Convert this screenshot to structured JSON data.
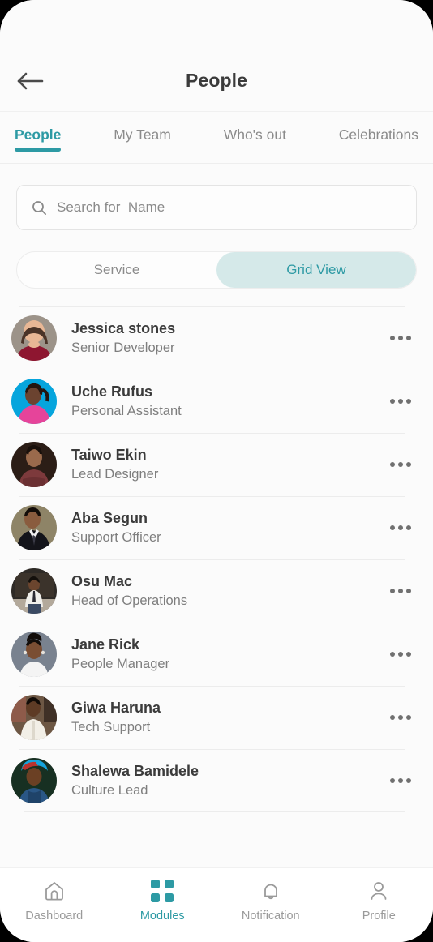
{
  "header": {
    "title": "People",
    "back_icon": "arrow-left-icon"
  },
  "tabs": [
    {
      "label": "People",
      "active": true
    },
    {
      "label": "My Team",
      "active": false
    },
    {
      "label": "Who's out",
      "active": false
    },
    {
      "label": "Celebrations",
      "active": false
    }
  ],
  "search": {
    "placeholder": "Search for  Name",
    "value": "",
    "icon": "search-icon"
  },
  "segmented": {
    "options": [
      {
        "label": "Service",
        "active": false
      },
      {
        "label": "Grid View",
        "active": true
      }
    ]
  },
  "people": [
    {
      "name": "Jessica stones",
      "role": "Senior Developer"
    },
    {
      "name": "Uche Rufus",
      "role": "Personal Assistant"
    },
    {
      "name": "Taiwo Ekin",
      "role": "Lead Designer"
    },
    {
      "name": "Aba Segun",
      "role": "Support Officer"
    },
    {
      "name": "Osu Mac",
      "role": "Head of Operations"
    },
    {
      "name": "Jane Rick",
      "role": "People Manager"
    },
    {
      "name": "Giwa Haruna",
      "role": "Tech Support"
    },
    {
      "name": "Shalewa Bamidele",
      "role": "Culture Lead"
    }
  ],
  "bottom_nav": [
    {
      "label": "Dashboard",
      "icon": "home-icon",
      "active": false
    },
    {
      "label": "Modules",
      "icon": "grid-icon",
      "active": true
    },
    {
      "label": "Notification",
      "icon": "bell-icon",
      "active": false
    },
    {
      "label": "Profile",
      "icon": "person-icon",
      "active": false
    }
  ],
  "colors": {
    "accent": "#2d9aa4",
    "accent_soft": "#d5e9e9",
    "text_primary": "#3b3b3b",
    "text_secondary": "#7e7e7e",
    "background": "#fbfbfb"
  }
}
